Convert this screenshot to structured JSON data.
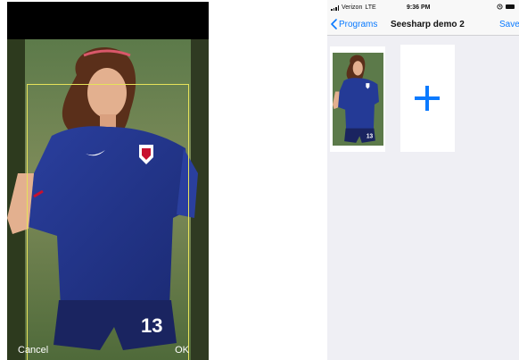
{
  "crop_screen": {
    "cancel_label": "Cancel",
    "ok_label": "OK",
    "crop_frame_color": "#e6e25a"
  },
  "status_bar": {
    "carrier": "Verizon",
    "network": "LTE",
    "time": "9:36 PM"
  },
  "nav": {
    "back_label": "Programs",
    "title": "Seesharp demo 2",
    "save_label": "Save"
  },
  "gallery": {
    "add_icon": "plus-icon",
    "accent_color": "#0a7aff"
  }
}
